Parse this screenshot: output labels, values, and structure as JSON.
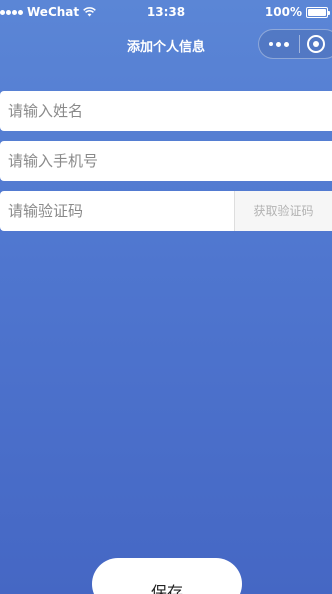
{
  "status_bar": {
    "carrier": "WeChat",
    "time": "13:38",
    "battery_percent": "100%",
    "battery_level": 1.0
  },
  "nav": {
    "title": "添加个人信息",
    "more_icon": "more-dots-icon",
    "close_icon": "target-icon"
  },
  "form": {
    "name_placeholder": "请输入姓名",
    "phone_placeholder": "请输入手机号",
    "code_placeholder": "请输验证码",
    "get_code_label": "获取验证码"
  },
  "actions": {
    "save_label": "保存"
  },
  "colors": {
    "background_top": "#5b86d6",
    "background_bottom": "#4567c4",
    "field_bg": "#ffffff",
    "placeholder": "#8a8a8a",
    "get_code_text": "#b2b2b2"
  }
}
